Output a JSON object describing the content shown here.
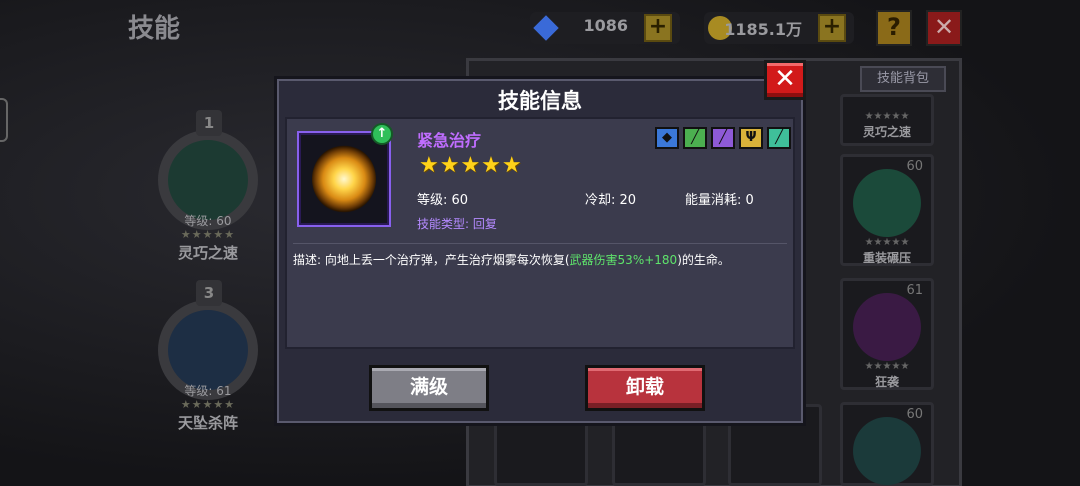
{
  "page": {
    "title": "技能"
  },
  "currency": {
    "gems": "1086",
    "gold": "1185.1万"
  },
  "top_buttons": {
    "help": "?",
    "close": "✕"
  },
  "bag_button": "技能背包",
  "equipped_slots": [
    {
      "num": "1",
      "level": "等级: 60",
      "name": "灵巧之速",
      "stars": "★★★★★"
    },
    {
      "num": "3",
      "level": "等级: 61",
      "name": "天坠杀阵",
      "stars": "★★★★★"
    }
  ],
  "bag_cards": [
    {
      "name": "灵巧之速",
      "level": "",
      "stars": "★★★★★"
    },
    {
      "name": "重装碾压",
      "level": "60",
      "stars": "★★★★★"
    },
    {
      "name": "狂袭",
      "level": "61",
      "stars": "★★★★★"
    },
    {
      "name": "",
      "level": "60",
      "stars": ""
    }
  ],
  "modal": {
    "title": "技能信息",
    "close": "✕",
    "skill_name": "紧急治疗",
    "stars": "★★★★★",
    "level_label": "等级: 60",
    "cooldown_label": "冷却: 20",
    "energy_label": "能量消耗: 0",
    "type_label": "技能类型: 回复",
    "description_prefix": "描述: 向地上丢一个治疗弹，产生治疗烟雾每次恢复(",
    "description_highlight": "武器伤害53%+180",
    "description_suffix": ")的生命。",
    "tags": [
      {
        "icon": "shield-icon",
        "glyph": "◆",
        "color": "#3b78d8"
      },
      {
        "icon": "sword-icon",
        "glyph": "╱",
        "color": "#4caf50"
      },
      {
        "icon": "staff-icon",
        "glyph": "╱",
        "color": "#8e5ad6"
      },
      {
        "icon": "trident-icon",
        "glyph": "Ψ",
        "color": "#d9b23a"
      },
      {
        "icon": "blade-icon",
        "glyph": "╱",
        "color": "#3fbf9a"
      }
    ],
    "buttons": {
      "full_level": "满级",
      "unload": "卸载"
    }
  }
}
